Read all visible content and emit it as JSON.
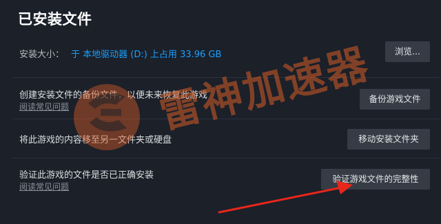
{
  "title": "已安装文件",
  "install_size": {
    "label": "安装大小：",
    "value": "于 本地驱动器 (D:) 上占用 33.96 GB",
    "browse_button": "浏览..."
  },
  "backup": {
    "text": "创建安装文件的备份文件，以便未来恢复此游戏",
    "faq_link": "阅读常见问题",
    "button": "备份游戏文件"
  },
  "move": {
    "text": "将此游戏的内容移至另一文件夹或硬盘",
    "button": "移动安装文件夹"
  },
  "verify": {
    "text": "验证此游戏的文件是否已正确安装",
    "faq_link": "阅读常见问题",
    "button": "验证游戏文件的完整性"
  },
  "watermark": {
    "text": "雷神加速器",
    "logo_icon": "leishen-logo-icon",
    "color": "#d65c26"
  },
  "annotation": {
    "arrow_icon": "red-arrow-icon",
    "color": "#e8261b"
  },
  "colors": {
    "background": "#1b2029",
    "accent": "#1a9fff",
    "button_bg": "#363c46"
  }
}
